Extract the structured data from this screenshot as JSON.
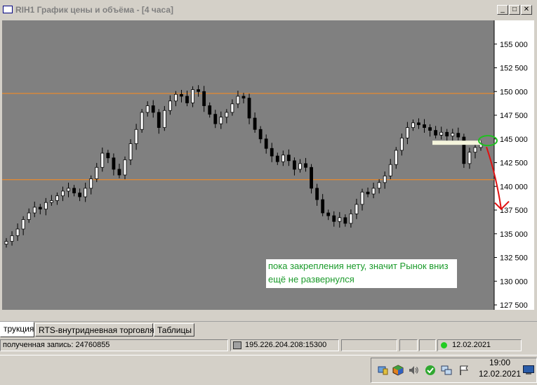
{
  "window": {
    "title": "RIH1 График цены и объёма - [4 часа]",
    "minimize": "_",
    "maximize": "□",
    "close": "✕"
  },
  "chart_data": {
    "type": "candlestick",
    "ylim": [
      127500,
      157500
    ],
    "yticks": [
      "155 000",
      "152 500",
      "150 000",
      "147 500",
      "145 000",
      "142 500",
      "140 000",
      "137 500",
      "135 000",
      "132 500",
      "130 000",
      "127 500"
    ],
    "tick_values": [
      155000,
      152500,
      150000,
      147500,
      145000,
      142500,
      140000,
      137500,
      135000,
      132500,
      130000,
      127500
    ],
    "horizontal_lines": [
      149800,
      140700
    ],
    "closes": [
      134200,
      134800,
      135500,
      136500,
      137200,
      137800,
      137600,
      138300,
      138500,
      139000,
      139500,
      139800,
      139300,
      138900,
      139800,
      140800,
      142000,
      143500,
      143000,
      141800,
      141200,
      142800,
      144500,
      146000,
      147800,
      148500,
      147800,
      146200,
      148000,
      149000,
      149700,
      149500,
      148800,
      150200,
      150000,
      148500,
      147600,
      146600,
      147300,
      147800,
      148700,
      149500,
      149300,
      147200,
      146000,
      145000,
      144000,
      143200,
      142600,
      143300,
      142700,
      141800,
      142400,
      142000,
      139800,
      138600,
      137200,
      136900,
      136300,
      136700,
      136100,
      137100,
      138100,
      139400,
      139200,
      139800,
      140400,
      141100,
      142300,
      143800,
      145100,
      146200,
      146700,
      146500,
      146200,
      145900,
      145400,
      145700,
      145300,
      145600,
      145200,
      142400,
      143600,
      144100,
      144500
    ],
    "resistance_level": 144600,
    "projected_target": 137600,
    "annotation": "пока закрепления нету, значит Рынок вниз ещё не развернулся",
    "colors": {
      "background": "#808080",
      "candle": "#000000",
      "level_line": "#ff8c1a",
      "arrow": "#e01010",
      "circle": "#20c020",
      "annotation_text": "#1a9a2a",
      "axis_bg": "#ffffff"
    }
  },
  "tabs": [
    {
      "label": "трукция",
      "active": true
    },
    {
      "label": "RTS-внутридневная торговля",
      "active": false
    },
    {
      "label": "Таблицы",
      "active": false
    }
  ],
  "status": {
    "records": "полученная запись: 24760855",
    "server": "195.226.204.208:15300",
    "date": "12.02.2021",
    "connection_color": "#22cc22"
  },
  "taskbar": {
    "time": "19:00",
    "date": "12.02.2021"
  }
}
